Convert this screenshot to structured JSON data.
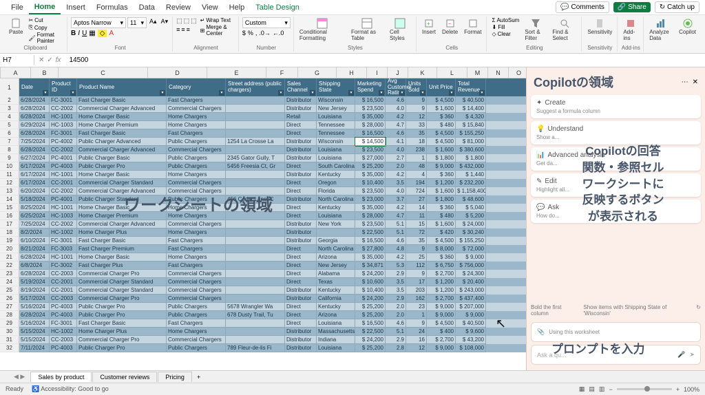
{
  "tabs": {
    "file": "File",
    "home": "Home",
    "insert": "Insert",
    "formulas": "Formulas",
    "data": "Data",
    "review": "Review",
    "view": "View",
    "help": "Help",
    "design": "Table Design"
  },
  "title_right": {
    "comments": "Comments",
    "share": "Share",
    "catchup": "Catch up"
  },
  "ribbon": {
    "clipboard": {
      "label": "Clipboard",
      "paste": "Paste",
      "cut": "Cut",
      "copy": "Copy",
      "painter": "Format Painter"
    },
    "font": {
      "label": "Font",
      "name": "Aptos Narrow",
      "size": "11"
    },
    "alignment": {
      "label": "Alignment",
      "wrap": "Wrap Text",
      "merge": "Merge & Center"
    },
    "number": {
      "label": "Number",
      "format": "Custom"
    },
    "styles": {
      "label": "Styles",
      "cond": "Conditional Formatting",
      "table": "Format as Table",
      "cell": "Cell Styles"
    },
    "cells": {
      "label": "Cells",
      "insert": "Insert",
      "delete": "Delete",
      "format": "Format"
    },
    "editing": {
      "label": "Editing",
      "sum": "AutoSum",
      "fill": "Fill",
      "clear": "Clear",
      "sort": "Sort & Filter",
      "find": "Find & Select"
    },
    "sensitivity": {
      "label": "Sensitivity",
      "btn": "Sensitivity"
    },
    "addins": {
      "label": "Add-ins",
      "btn": "Add-ins"
    },
    "analyze": "Analyze Data",
    "copilot": "Copilot"
  },
  "formula_bar": {
    "name_box": "H7",
    "value": "14500"
  },
  "col_letters": [
    "A",
    "B",
    "C",
    "D",
    "E",
    "F",
    "G",
    "H",
    "I",
    "J",
    "K",
    "L"
  ],
  "headers": [
    "Date",
    "Product ID",
    "Product Name",
    "Category",
    "Street address (public chargers)",
    "Sales Channel",
    "Shipping State",
    "Marketing Spend",
    "Avg Customer Rating",
    "Units Sold",
    "Unit Price",
    "Total Revenue"
  ],
  "rows": [
    {
      "date": "6/28/2024",
      "pid": "FC-3001",
      "name": "Fast Charger Basic",
      "cat": "Fast Chargers",
      "addr": "",
      "chan": "Distributor",
      "ship": "Wisconsin",
      "mkt": "$ 16,500",
      "avg": "4.6",
      "sold": "9",
      "price": "$ 4,500",
      "rev": "$ 40,500"
    },
    {
      "date": "6/28/2024",
      "pid": "CC-2002",
      "name": "Commercial Charger Advanced",
      "cat": "Commercial Chargers",
      "addr": "",
      "chan": "Distributor",
      "ship": "New Jersey",
      "mkt": "$ 23,500",
      "avg": "4.0",
      "sold": "9",
      "price": "$ 1,600",
      "rev": "$ 14,400"
    },
    {
      "date": "6/28/2024",
      "pid": "HC-1001",
      "name": "Home Charger Basic",
      "cat": "Home Chargers",
      "addr": "",
      "chan": "Retail",
      "ship": "Louisiana",
      "mkt": "$ 35,000",
      "avg": "4.2",
      "sold": "12",
      "price": "$ 360",
      "rev": "$ 4,320"
    },
    {
      "date": "6/29/2024",
      "pid": "HC-1003",
      "name": "Home Charger Premium",
      "cat": "Home Chargers",
      "addr": "",
      "chan": "Direct",
      "ship": "Tennessee",
      "mkt": "$ 28,000",
      "avg": "4.7",
      "sold": "33",
      "price": "$ 480",
      "rev": "$ 15,840"
    },
    {
      "date": "6/28/2024",
      "pid": "FC-3001",
      "name": "Fast Charger Basic",
      "cat": "Fast Chargers",
      "addr": "",
      "chan": "Direct",
      "ship": "Tennessee",
      "mkt": "$ 16,500",
      "avg": "4.6",
      "sold": "35",
      "price": "$ 4,500",
      "rev": "$ 155,250"
    },
    {
      "date": "7/25/2024",
      "pid": "PC-4002",
      "name": "Public Charger Advanced",
      "cat": "Public Chargers",
      "addr": "1254 La Crosse La",
      "chan": "Distributor",
      "ship": "Wisconsin",
      "mkt": "$ 14,500",
      "avg": "4.1",
      "sold": "18",
      "price": "$ 4,500",
      "rev": "$ 81,000"
    },
    {
      "date": "6/28/2024",
      "pid": "CC-2002",
      "name": "Commercial Charger Advanced",
      "cat": "Commercial Chargers",
      "addr": "",
      "chan": "Distributor",
      "ship": "Louisiana",
      "mkt": "$ 23,500",
      "avg": "4.0",
      "sold": "238",
      "price": "$ 1,600",
      "rev": "$ 380,600"
    },
    {
      "date": "6/27/2024",
      "pid": "PC-4001",
      "name": "Public Charger Basic",
      "cat": "Public Chargers",
      "addr": "2345 Gator Gully, T",
      "chan": "Distributor",
      "ship": "Louisiana",
      "mkt": "$ 27,000",
      "avg": "2.7",
      "sold": "1",
      "price": "$ 1,800",
      "rev": "$ 1,800"
    },
    {
      "date": "6/17/2024",
      "pid": "PC-4003",
      "name": "Public Charger Pro",
      "cat": "Public Chargers",
      "addr": "5456 Freesia Ct, Gr",
      "chan": "Direct",
      "ship": "South Carolina",
      "mkt": "$ 25,200",
      "avg": "2.0",
      "sold": "48",
      "price": "$ 9,000",
      "rev": "$ 432,000"
    },
    {
      "date": "6/17/2024",
      "pid": "HC-1001",
      "name": "Home Charger Basic",
      "cat": "Home Chargers",
      "addr": "",
      "chan": "Distributor",
      "ship": "Kentucky",
      "mkt": "$ 35,000",
      "avg": "4.2",
      "sold": "4",
      "price": "$ 360",
      "rev": "$ 1,440"
    },
    {
      "date": "6/17/2024",
      "pid": "CC-2001",
      "name": "Commercial Charger Standard",
      "cat": "Commercial Chargers",
      "addr": "",
      "chan": "Direct",
      "ship": "Oregon",
      "mkt": "$ 10,400",
      "avg": "3.5",
      "sold": "194",
      "price": "$ 1,200",
      "rev": "$ 232,200"
    },
    {
      "date": "6/20/2024",
      "pid": "CC-2002",
      "name": "Commercial Charger Advanced",
      "cat": "Commercial Chargers",
      "addr": "",
      "chan": "Direct",
      "ship": "Florida",
      "mkt": "$ 23,500",
      "avg": "4.0",
      "sold": "724",
      "price": "$ 1,600",
      "rev": "$ 1,158,400"
    },
    {
      "date": "5/18/2024",
      "pid": "PC-4001",
      "name": "Public Charger Standard",
      "cat": "Public Chargers",
      "addr": "456 Cedar Lane, C",
      "chan": "Distributor",
      "ship": "North Carolina",
      "mkt": "$ 23,000",
      "avg": "3.7",
      "sold": "27",
      "price": "$ 1,800",
      "rev": "$ 48,600"
    },
    {
      "date": "8/25/2024",
      "pid": "HC-1001",
      "name": "Home Charger Basic",
      "cat": "Home Chargers",
      "addr": "",
      "chan": "Direct",
      "ship": "Kentucky",
      "mkt": "$ 35,000",
      "avg": "4.2",
      "sold": "14",
      "price": "$ 360",
      "rev": "$ 5,040"
    },
    {
      "date": "6/25/2024",
      "pid": "HC-1003",
      "name": "Home Charger Premium",
      "cat": "Home Chargers",
      "addr": "",
      "chan": "Direct",
      "ship": "Louisiana",
      "mkt": "$ 28,000",
      "avg": "4.7",
      "sold": "11",
      "price": "$ 480",
      "rev": "$ 5,200"
    },
    {
      "date": "7/25/2024",
      "pid": "CC-2002",
      "name": "Commercial Charger Advanced",
      "cat": "Commercial Chargers",
      "addr": "",
      "chan": "Distributor",
      "ship": "New York",
      "mkt": "$ 23,500",
      "avg": "5.1",
      "sold": "15",
      "price": "$ 1,600",
      "rev": "$ 24,000"
    },
    {
      "date": "8/2/2024",
      "pid": "HC-1002",
      "name": "Home Charger Plus",
      "cat": "Home Chargers",
      "addr": "",
      "chan": "Distributor",
      "ship": "",
      "mkt": "$ 22,500",
      "avg": "5.1",
      "sold": "72",
      "price": "$ 420",
      "rev": "$ 30,240"
    },
    {
      "date": "6/10/2024",
      "pid": "FC-3001",
      "name": "Fast Charger Basic",
      "cat": "Fast Chargers",
      "addr": "",
      "chan": "Distributor",
      "ship": "Georgia",
      "mkt": "$ 16,500",
      "avg": "4.6",
      "sold": "35",
      "price": "$ 4,500",
      "rev": "$ 155,250"
    },
    {
      "date": "8/21/2024",
      "pid": "FC-3003",
      "name": "Fast Charger Premium",
      "cat": "Fast Chargers",
      "addr": "",
      "chan": "Direct",
      "ship": "North Carolina",
      "mkt": "$ 27,800",
      "avg": "4.8",
      "sold": "9",
      "price": "$ 8,000",
      "rev": "$ 72,000"
    },
    {
      "date": "6/28/2024",
      "pid": "HC-1001",
      "name": "Home Charger Basic",
      "cat": "Home Chargers",
      "addr": "",
      "chan": "Direct",
      "ship": "Arizona",
      "mkt": "$ 35,000",
      "avg": "4.2",
      "sold": "25",
      "price": "$ 360",
      "rev": "$ 9,000"
    },
    {
      "date": "6/8/2024",
      "pid": "FC-3002",
      "name": "Fast Charger Plus",
      "cat": "Fast Chargers",
      "addr": "",
      "chan": "Direct",
      "ship": "New Jersey",
      "mkt": "$ 34,871",
      "avg": "5.3",
      "sold": "112",
      "price": "$ 6,750",
      "rev": "$ 756,000"
    },
    {
      "date": "6/28/2024",
      "pid": "CC-2003",
      "name": "Commercial Charger Pro",
      "cat": "Commercial Chargers",
      "addr": "",
      "chan": "Direct",
      "ship": "Alabama",
      "mkt": "$ 24,200",
      "avg": "2.9",
      "sold": "9",
      "price": "$ 2,700",
      "rev": "$ 24,300"
    },
    {
      "date": "5/19/2024",
      "pid": "CC-2001",
      "name": "Commercial Charger Standard",
      "cat": "Commercial Chargers",
      "addr": "",
      "chan": "Direct",
      "ship": "Texas",
      "mkt": "$ 10,600",
      "avg": "3.5",
      "sold": "17",
      "price": "$ 1,200",
      "rev": "$ 20,400"
    },
    {
      "date": "8/19/2024",
      "pid": "CC-2001",
      "name": "Commercial Charger Standard",
      "cat": "Commercial Chargers",
      "addr": "",
      "chan": "Distributor",
      "ship": "Kentucky",
      "mkt": "$ 10,400",
      "avg": "3.5",
      "sold": "203",
      "price": "$ 1,200",
      "rev": "$ 243,000"
    },
    {
      "date": "5/17/2024",
      "pid": "CC-2003",
      "name": "Commercial Charger Pro",
      "cat": "Commercial Chargers",
      "addr": "",
      "chan": "Distributor",
      "ship": "California",
      "mkt": "$ 24,200",
      "avg": "2.9",
      "sold": "162",
      "price": "$ 2,700",
      "rev": "$ 437,400"
    },
    {
      "date": "5/16/2024",
      "pid": "PC-4003",
      "name": "Public Charger Pro",
      "cat": "Public Chargers",
      "addr": "5678 Wrangler Wa",
      "chan": "Direct",
      "ship": "Kentucky",
      "mkt": "$ 25,200",
      "avg": "2.0",
      "sold": "23",
      "price": "$ 9,000",
      "rev": "$ 207,000"
    },
    {
      "date": "6/28/2024",
      "pid": "PC-4003",
      "name": "Public Charger Pro",
      "cat": "Public Chargers",
      "addr": "678 Dusty Trail, Tu",
      "chan": "Direct",
      "ship": "Arizona",
      "mkt": "$ 25,200",
      "avg": "2.0",
      "sold": "1",
      "price": "$ 9,000",
      "rev": "$ 9,000"
    },
    {
      "date": "5/16/2024",
      "pid": "FC-3001",
      "name": "Fast Charger Basic",
      "cat": "Fast Chargers",
      "addr": "",
      "chan": "Direct",
      "ship": "Louisiana",
      "mkt": "$ 16,500",
      "avg": "4.6",
      "sold": "9",
      "price": "$ 4,500",
      "rev": "$ 40,500"
    },
    {
      "date": "5/15/2024",
      "pid": "HC-1002",
      "name": "Home Charger Plus",
      "cat": "Home Chargers",
      "addr": "",
      "chan": "Distributor",
      "ship": "Massachusetts",
      "mkt": "$ 22,500",
      "avg": "5.1",
      "sold": "24",
      "price": "$ 400",
      "rev": "$ 9,600"
    },
    {
      "date": "5/15/2024",
      "pid": "CC-2003",
      "name": "Commercial Charger Pro",
      "cat": "Commercial Chargers",
      "addr": "",
      "chan": "Distributor",
      "ship": "Indiana",
      "mkt": "$ 24,200",
      "avg": "2.9",
      "sold": "16",
      "price": "$ 2,700",
      "rev": "$ 43,200"
    },
    {
      "date": "7/11/2024",
      "pid": "PC-4003",
      "name": "Public Charger Pro",
      "cat": "Public Chargers",
      "addr": "789 Fleur-de-lis Fi",
      "chan": "Distributor",
      "ship": "Louisiana",
      "mkt": "$ 25,200",
      "avg": "2.8",
      "sold": "12",
      "price": "$ 9,000",
      "rev": "$ 108,000"
    }
  ],
  "copilot": {
    "title": "Copilotの領域",
    "create": {
      "h": "Create",
      "s": "Suggest a formula column"
    },
    "understand": {
      "h": "Understand",
      "s": "Show a..."
    },
    "adv": {
      "h": "Advanced analysis",
      "s": "Get da..."
    },
    "edit": {
      "h": "Edit",
      "s": "Highlight all..."
    },
    "ask": {
      "h": "Ask",
      "s": "How do..."
    },
    "sugg": {
      "a": "Bold the first column",
      "b": "Show items with Shipping State of 'Wisconsin'"
    },
    "using": "Using this worksheet",
    "input": "Ask a qu...",
    "overlay_answer": "Copilotの回答\n関数・参照セル\nワークシートに\n反映するボタン\nが表示される",
    "overlay_prompt": "プロンプトを入力"
  },
  "overlay_ws": "ワークシートの領域",
  "sheets": {
    "sales": "Sales by product",
    "reviews": "Customer reviews",
    "pricing": "Pricing"
  },
  "status": {
    "ready": "Ready",
    "access": "Accessibility: Good to go",
    "zoom": "100%"
  }
}
